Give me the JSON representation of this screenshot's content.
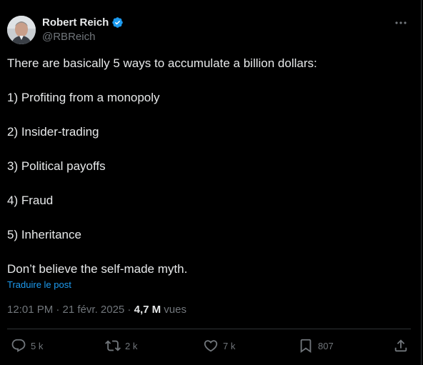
{
  "author": {
    "display_name": "Robert Reich",
    "handle": "@RBReich",
    "verified": true
  },
  "tweet": {
    "lines": [
      "There are basically 5 ways to accumulate a billion dollars:",
      "1) Profiting from a monopoly",
      "2) Insider-trading",
      "3) Political payoffs",
      "4) Fraud",
      "5) Inheritance",
      "Don’t believe the self-made myth."
    ],
    "translate_label": "Traduire le post",
    "timestamp": "12:01 PM · 21 févr. 2025 · ",
    "views_count": "4,7 M",
    "views_label": " vues"
  },
  "actions": {
    "replies": "5 k",
    "reposts": "2 k",
    "likes": "7 k",
    "bookmarks": "807"
  },
  "colors": {
    "background": "#000000",
    "text": "#e7e9ea",
    "muted": "#71767b",
    "accent": "#1d9bf0",
    "border": "#2f3336"
  }
}
